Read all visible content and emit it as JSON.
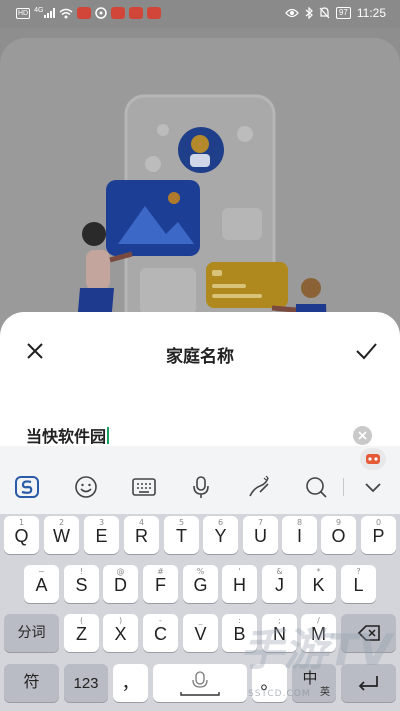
{
  "status_bar": {
    "network_label": "HD",
    "network_gen": "4G",
    "battery": "97",
    "time": "11:25"
  },
  "sheet": {
    "title": "家庭名称",
    "input_value": "当快软件园"
  },
  "keyboard": {
    "row1": [
      {
        "main": "Q",
        "hint": "1"
      },
      {
        "main": "W",
        "hint": "2"
      },
      {
        "main": "E",
        "hint": "3"
      },
      {
        "main": "R",
        "hint": "4"
      },
      {
        "main": "T",
        "hint": "5"
      },
      {
        "main": "Y",
        "hint": "6"
      },
      {
        "main": "U",
        "hint": "7"
      },
      {
        "main": "I",
        "hint": "8"
      },
      {
        "main": "O",
        "hint": "9"
      },
      {
        "main": "P",
        "hint": "0"
      }
    ],
    "row2": [
      {
        "main": "A",
        "hint": "~"
      },
      {
        "main": "S",
        "hint": "!"
      },
      {
        "main": "D",
        "hint": "@"
      },
      {
        "main": "F",
        "hint": "#"
      },
      {
        "main": "G",
        "hint": "%"
      },
      {
        "main": "H",
        "hint": "'"
      },
      {
        "main": "J",
        "hint": "&"
      },
      {
        "main": "K",
        "hint": "*"
      },
      {
        "main": "L",
        "hint": "?"
      }
    ],
    "row3": [
      {
        "main": "Z",
        "hint": "("
      },
      {
        "main": "X",
        "hint": ")"
      },
      {
        "main": "C",
        "hint": "-"
      },
      {
        "main": "V",
        "hint": "_"
      },
      {
        "main": "B",
        "hint": ":"
      },
      {
        "main": "N",
        "hint": ";"
      },
      {
        "main": "M",
        "hint": "/"
      }
    ],
    "fenci": "分词",
    "symbol": "符",
    "num": "123",
    "comma": "，",
    "period": "。",
    "lang_main": "中",
    "lang_sub": "英"
  },
  "watermark": {
    "text": "手游TV",
    "url": "SSTCD.COM"
  },
  "colors": {
    "caret": "#1aa260",
    "accent": "#2b6fd6",
    "keyboard_bg": "#d3d5da"
  }
}
